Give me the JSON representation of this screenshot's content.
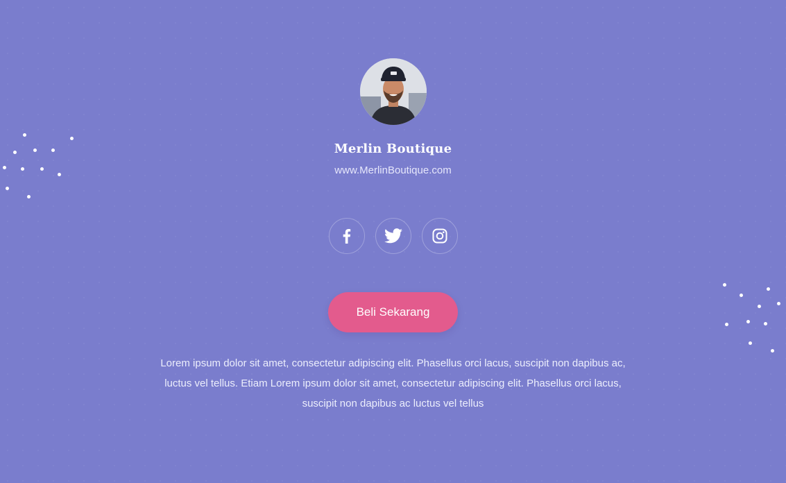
{
  "profile": {
    "name": "Merlin Boutique",
    "website": "www.MerlinBoutique.com"
  },
  "social": {
    "icons": [
      "facebook-icon",
      "twitter-icon",
      "instagram-icon"
    ]
  },
  "cta": {
    "label": "Beli Sekarang"
  },
  "description": "Lorem ipsum dolor sit amet, consectetur adipiscing elit. Phasellus orci lacus, suscipit non dapibus ac, luctus vel tellus. Etiam Lorem ipsum dolor sit amet, consectetur adipiscing elit. Phasellus orci lacus, suscipit non dapibus ac luctus vel tellus",
  "colors": {
    "background": "#7a7dcd",
    "button": "#e35b8d",
    "text": "#ffffff"
  }
}
